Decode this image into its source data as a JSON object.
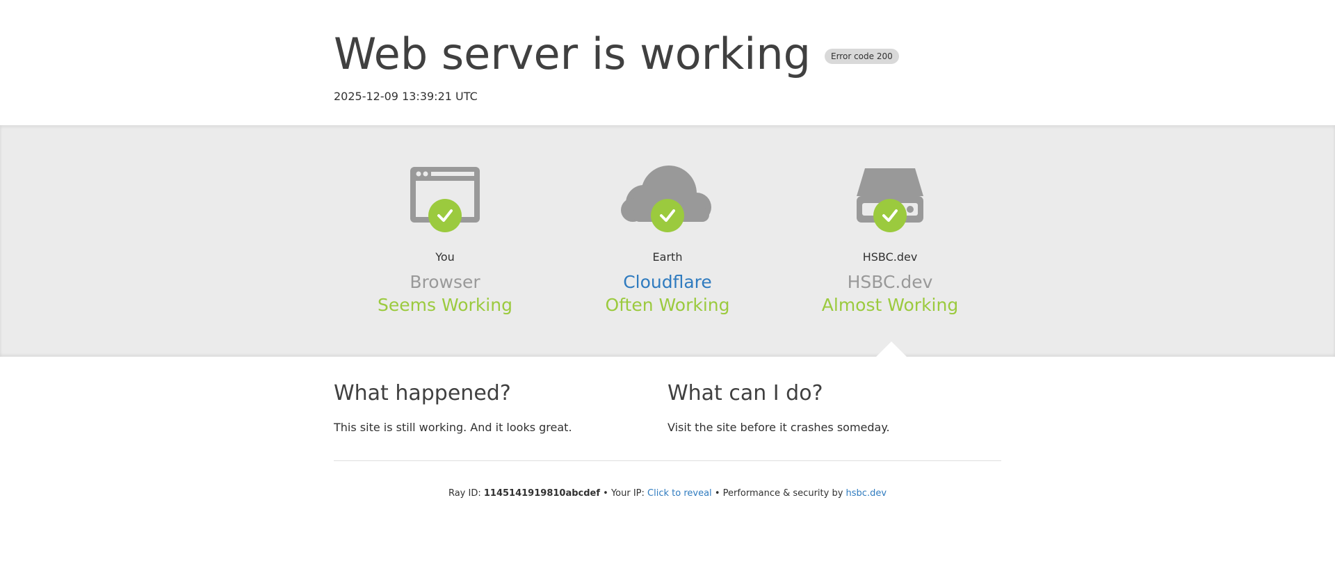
{
  "header": {
    "title": "Web server is working",
    "badge": "Error code 200",
    "timestamp": "2025-12-09 13:39:21 UTC"
  },
  "status": [
    {
      "location": "You",
      "name": "Browser",
      "state": "Seems Working",
      "icon": "browser-icon"
    },
    {
      "location": "Earth",
      "name": "Cloudflare",
      "state": "Often Working",
      "icon": "cloud-icon"
    },
    {
      "location": "HSBC.dev",
      "name": "HSBC.dev",
      "state": "Almost Working",
      "icon": "server-icon"
    }
  ],
  "info": {
    "what_happened_title": "What happened?",
    "what_happened_text": "This site is still working. And it looks great.",
    "what_can_do_title": "What can I do?",
    "what_can_do_text": "Visit the site before it crashes someday."
  },
  "footer": {
    "ray_label": "Ray ID:",
    "ray_id": "1145141919810abcdef",
    "ip_label": "Your IP:",
    "ip_link": "Click to reveal",
    "perf_label": "Performance & security by",
    "perf_link": "hsbc.dev"
  },
  "colors": {
    "accent_green": "#9bca3e",
    "link_blue": "#2f7bbf",
    "icon_gray": "#999999",
    "band_bg": "#ebebeb"
  }
}
